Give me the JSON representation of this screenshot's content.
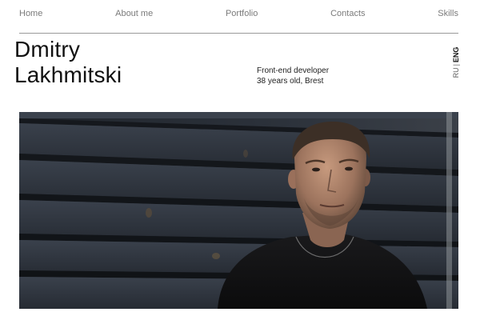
{
  "nav": {
    "items": [
      {
        "label": "Home"
      },
      {
        "label": "About me"
      },
      {
        "label": "Portfolio"
      },
      {
        "label": "Contacts"
      },
      {
        "label": "Skills"
      }
    ]
  },
  "profile": {
    "first_name": "Dmitry",
    "last_name": "Lakhmitski",
    "role": "Front-end developer",
    "details": "38 years old, Brest"
  },
  "language": {
    "options": [
      "RU",
      "ENG"
    ],
    "separator": "|",
    "active": "ENG"
  },
  "hero": {
    "subject": "portrait photo of a man in a black t-shirt in front of dark wooden planks"
  },
  "colors": {
    "nav_text": "#7b7b7b",
    "rule": "#9a9a9a",
    "heading": "#111111",
    "photo_planks": "#2f3540"
  }
}
